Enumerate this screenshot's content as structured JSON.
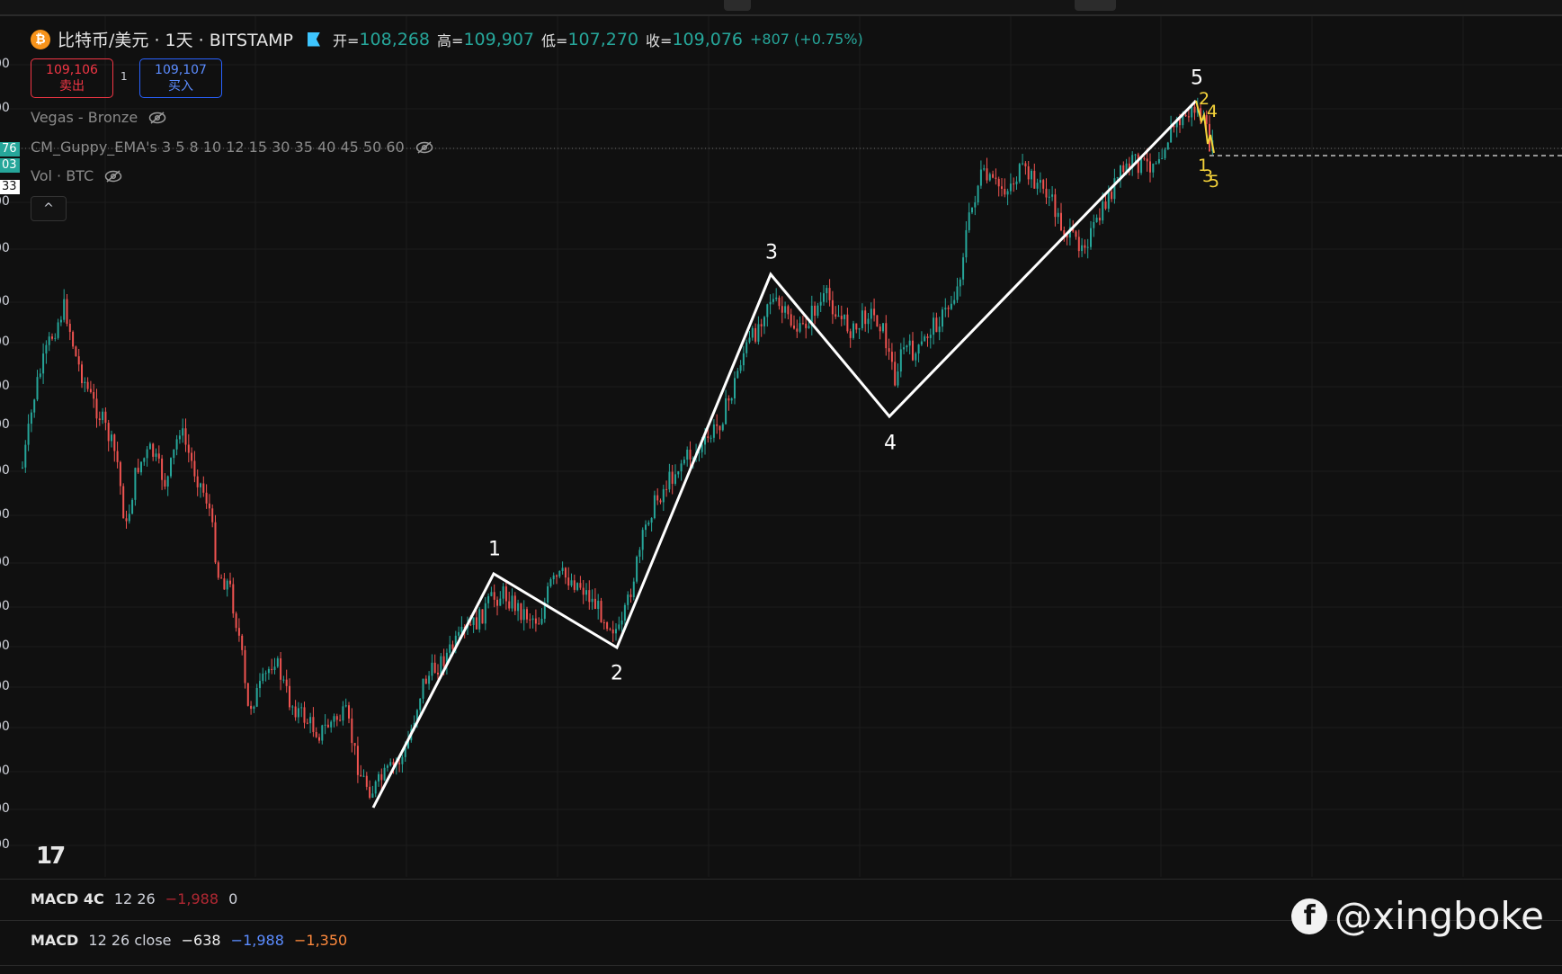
{
  "header": {
    "symbol": "比特币/美元 · 1天 · BITSTAMP",
    "btc_icon": "₿",
    "open_label": "开=",
    "open_value": "108,268",
    "high_label": "高=",
    "high_value": "109,907",
    "low_label": "低=",
    "low_value": "107,270",
    "close_label": "收=",
    "close_value": "109,076",
    "change": "+807 (+0.75%)"
  },
  "trade": {
    "sell_price": "109,106",
    "sell_label": "卖出",
    "spread": "1",
    "buy_price": "109,107",
    "buy_label": "买入"
  },
  "indicators": {
    "vegas": "Vegas - Bronze",
    "guppy": "CM_Guppy_EMA's 3 5 8 10 12 15 30 35 40 45 50 60",
    "vol": "Vol · BTC",
    "collapse": "^"
  },
  "y_axis": {
    "tick_text": "00",
    "label_boxes": [
      "76",
      "03",
      "33"
    ]
  },
  "logo": "17",
  "macd_panes": {
    "pane1_name": "MACD 4C",
    "pane1_params": "12 26",
    "pane1_v1": "−1,988",
    "pane1_v2": "0",
    "pane2_name": "MACD",
    "pane2_params": "12 26 close",
    "pane2_v1": "−638",
    "pane2_v2": "−1,988",
    "pane2_v3": "−1,350"
  },
  "watermark": "@xingboke",
  "colors": {
    "background": "#101010",
    "candle_up": "#26a69a",
    "candle_down": "#ef5350",
    "wave_line": "#ffffff",
    "subwave": "#f5d33a",
    "sell": "#f23645",
    "buy": "#2962ff"
  },
  "chart_data": {
    "type": "candlestick",
    "title": "比特币/美元 · 1天 · BITSTAMP",
    "ohlc_last": {
      "open": 108268,
      "high": 109907,
      "low": 107270,
      "close": 109076
    },
    "elliott_waves": {
      "labels": [
        "1",
        "2",
        "3",
        "4",
        "5"
      ],
      "subwave_labels": [
        "1",
        "2",
        "3",
        "4",
        "5"
      ]
    },
    "grid": true
  }
}
